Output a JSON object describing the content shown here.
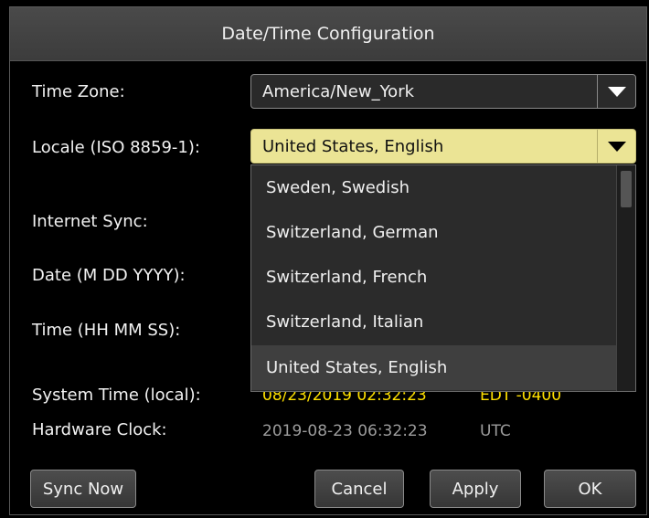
{
  "dialog": {
    "title": "Date/Time Configuration"
  },
  "labels": {
    "time_zone": "Time Zone:",
    "locale": "Locale (ISO 8859-1):",
    "internet_sync": "Internet Sync:",
    "date": "Date (M DD YYYY):",
    "time": "Time (HH MM SS):",
    "system_time": "System Time (local):",
    "hardware_clock": "Hardware Clock:"
  },
  "time_zone": {
    "selected": "America/New_York",
    "icon": "chevron-down-icon"
  },
  "locale": {
    "selected": "United States, English",
    "icon": "chevron-down-icon",
    "options": [
      {
        "label": "Sweden, Swedish"
      },
      {
        "label": "Switzerland, German"
      },
      {
        "label": "Switzerland, French"
      },
      {
        "label": "Switzerland, Italian"
      },
      {
        "label": "United States, English",
        "selected": true
      }
    ]
  },
  "system_time": {
    "value": "08/23/2019 02:32:23",
    "zone": "EDT -0400"
  },
  "hardware_clock": {
    "value": "2019-08-23 06:32:23",
    "zone": "UTC"
  },
  "buttons": {
    "sync_now": "Sync Now",
    "cancel": "Cancel",
    "apply": "Apply",
    "ok": "OK"
  },
  "colors": {
    "highlight": "#ebe495",
    "system_time_text": "#ffe000",
    "hardware_clock_text": "#9c9c9c"
  }
}
